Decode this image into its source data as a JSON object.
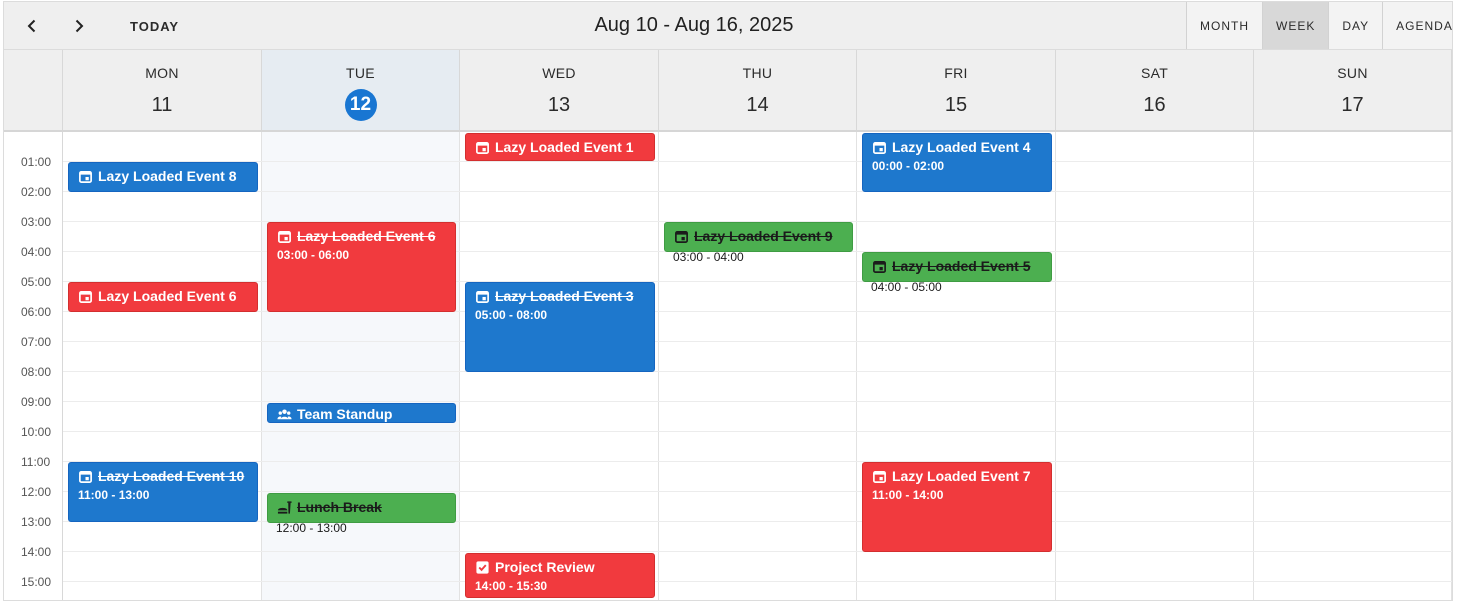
{
  "toolbar": {
    "prev_label": "Previous",
    "next_label": "Next",
    "today_label": "TODAY",
    "range_title": "Aug 10 - Aug 16, 2025",
    "views": [
      "MONTH",
      "WEEK",
      "DAY",
      "AGENDA"
    ],
    "active_view": "WEEK"
  },
  "days": [
    {
      "name": "MON",
      "num": "11"
    },
    {
      "name": "TUE",
      "num": "12",
      "today": true
    },
    {
      "name": "WED",
      "num": "13"
    },
    {
      "name": "THU",
      "num": "14"
    },
    {
      "name": "FRI",
      "num": "15"
    },
    {
      "name": "SAT",
      "num": "16"
    },
    {
      "name": "SUN",
      "num": "17"
    }
  ],
  "hours": [
    "01:00",
    "02:00",
    "03:00",
    "04:00",
    "05:00",
    "06:00",
    "07:00",
    "08:00",
    "09:00",
    "10:00",
    "11:00",
    "12:00",
    "13:00",
    "14:00",
    "15:00"
  ],
  "events": [
    {
      "title": "Lazy Loaded Event 8",
      "time": "",
      "color": "#1e78cd",
      "icon": "calendar-icon",
      "strike": false
    },
    {
      "title": "Lazy Loaded Event 6",
      "time": "",
      "color": "#f13a3e",
      "icon": "calendar-icon",
      "strike": false
    },
    {
      "title": "Lazy Loaded Event 10",
      "time": "11:00 - 13:00",
      "color": "#1e78cd",
      "icon": "calendar-icon",
      "strike": true
    },
    {
      "title": "Lazy Loaded Event 6",
      "time": "03:00 - 06:00",
      "color": "#f13a3e",
      "icon": "calendar-icon",
      "strike": true
    },
    {
      "title": "Team Standup",
      "time": "",
      "color": "#1e78cd",
      "icon": "group-icon",
      "strike": false
    },
    {
      "title": "Lunch Break",
      "time": "12:00 - 13:00",
      "color": "#4caf50",
      "icon": "food-icon",
      "strike": true
    },
    {
      "title": "Lazy Loaded Event 1",
      "time": "",
      "color": "#f13a3e",
      "icon": "calendar-icon",
      "strike": false
    },
    {
      "title": "Lazy Loaded Event 3",
      "time": "05:00 - 08:00",
      "color": "#1e78cd",
      "icon": "calendar-icon",
      "strike": true
    },
    {
      "title": "Project Review",
      "time": "14:00 - 15:30",
      "color": "#f13a3e",
      "icon": "checkbox-icon",
      "strike": false
    },
    {
      "title": "Lazy Loaded Event 9",
      "time": "03:00 - 04:00",
      "color": "#4caf50",
      "icon": "calendar-icon",
      "strike": true
    },
    {
      "title": "Lazy Loaded Event 4",
      "time": "00:00 - 02:00",
      "color": "#1e78cd",
      "icon": "calendar-icon",
      "strike": false
    },
    {
      "title": "Lazy Loaded Event 5",
      "time": "04:00 - 05:00",
      "color": "#4caf50",
      "icon": "calendar-icon",
      "strike": true
    },
    {
      "title": "Lazy Loaded Event 7",
      "time": "11:00 - 14:00",
      "color": "#f13a3e",
      "icon": "calendar-icon",
      "strike": false
    }
  ]
}
